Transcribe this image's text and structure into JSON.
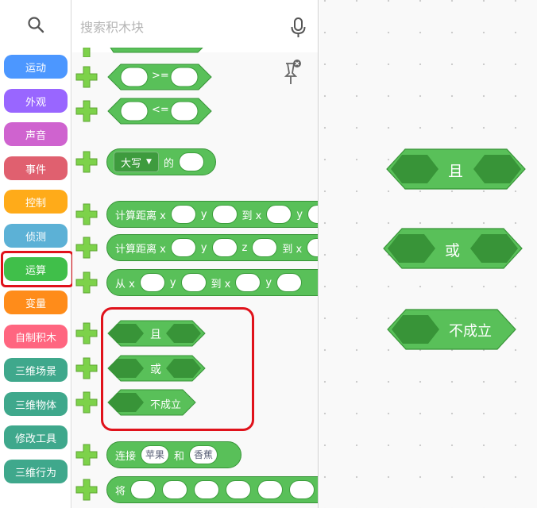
{
  "search": {
    "placeholder": "搜索积木块"
  },
  "categories": [
    {
      "label": "运动",
      "color": "#4c97ff"
    },
    {
      "label": "外观",
      "color": "#9966ff"
    },
    {
      "label": "声音",
      "color": "#cf63cf"
    },
    {
      "label": "事件",
      "color": "#e0606f"
    },
    {
      "label": "控制",
      "color": "#ffab19"
    },
    {
      "label": "侦测",
      "color": "#5cb1d6"
    },
    {
      "label": "运算",
      "color": "#40bf4a",
      "selected": true
    },
    {
      "label": "变量",
      "color": "#ff8c1a"
    },
    {
      "label": "自制积木",
      "color": "#ff6680"
    },
    {
      "label": "三维场景",
      "color": "#3fa88c"
    },
    {
      "label": "三维物体",
      "color": "#3fa88c"
    },
    {
      "label": "修改工具",
      "color": "#3fa88c"
    },
    {
      "label": "三维行为",
      "color": "#3fa88c"
    }
  ],
  "palette": {
    "compare_ge": ">=",
    "compare_le": "<=",
    "case_dropdown": "大写",
    "case_of": "的",
    "distance2d": {
      "label": "计算距离 x",
      "y": "y",
      "to_x": "到 x",
      "y2": "y"
    },
    "distance3d": {
      "label": "计算距离 x",
      "y": "y",
      "z": "z",
      "to_x": "到 x"
    },
    "from": {
      "label": "从 x",
      "y": "y",
      "to_x": "到 x",
      "y2": "y"
    },
    "and_label": "且",
    "or_label": "或",
    "not_label": "不成立",
    "join": {
      "label": "连接",
      "apple": "苹果",
      "and": "和",
      "banana": "香蕉"
    },
    "put": {
      "label": "将"
    }
  },
  "workspace": {
    "and_label": "且",
    "or_label": "或",
    "not_label": "不成立"
  },
  "colors": {
    "operator_green": "#59c059",
    "operator_dark": "#389438",
    "slot_dark": "#3d9e3d",
    "highlight_red": "#e0121b"
  }
}
